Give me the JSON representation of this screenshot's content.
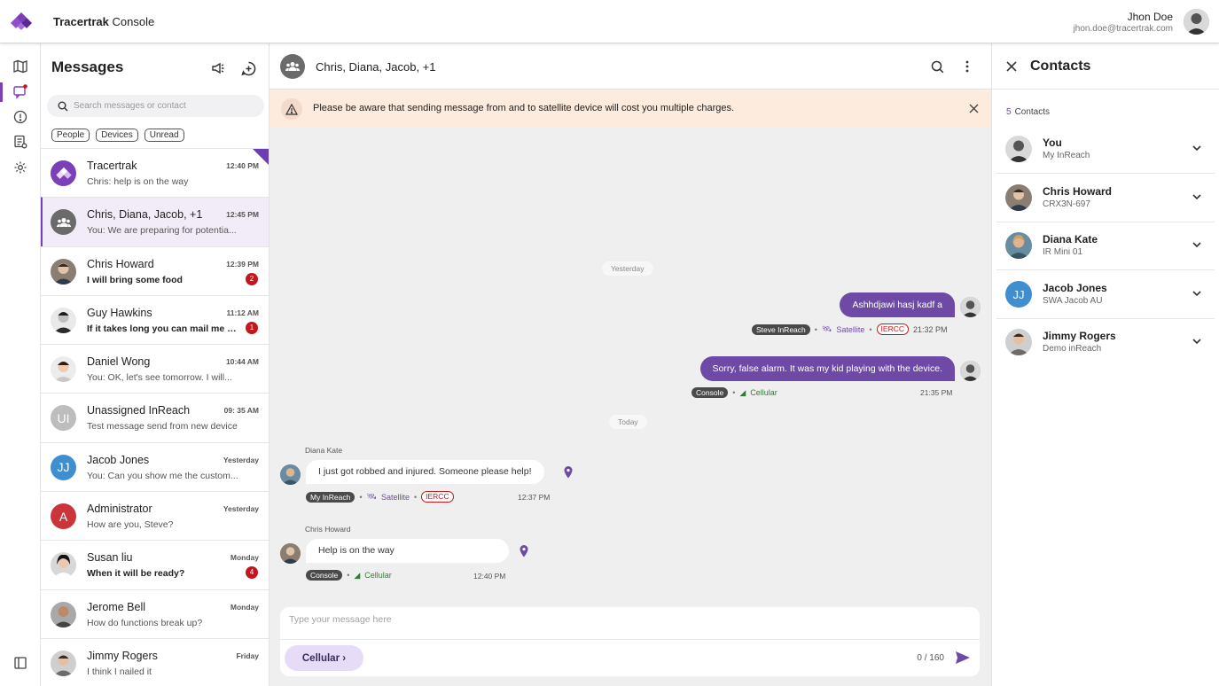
{
  "app": {
    "name_bold": "Tracertrak",
    "name_rest": " Console"
  },
  "user": {
    "name": "Jhon Doe",
    "email": "jhon.doe@tracertrak.com"
  },
  "messages_panel": {
    "title": "Messages",
    "search_placeholder": "Search messages or contact",
    "filters": [
      "People",
      "Devices",
      "Unread"
    ],
    "conversations": [
      {
        "name": "Tracertrak",
        "time": "12:40 PM",
        "preview": "Chris: help is on the way",
        "unread": "",
        "avatar": "logo",
        "active": false
      },
      {
        "name": "Chris, Diana, Jacob, +1",
        "time": "12:45 PM",
        "preview": "You: We are preparing for potentia...",
        "unread": "",
        "avatar": "group",
        "active": true
      },
      {
        "name": "Chris Howard",
        "time": "12:39 PM",
        "preview": "I will bring some food",
        "unread": "2",
        "avatar": "photo",
        "active": false
      },
      {
        "name": "Guy Hawkins",
        "time": "11:12 AM",
        "preview": "If it takes long you can mail me wi...",
        "unread": "1",
        "avatar": "photo",
        "active": false
      },
      {
        "name": "Daniel Wong",
        "time": "10:44 AM",
        "preview": "You: OK, let's see tomorrow. I will...",
        "unread": "",
        "avatar": "photo",
        "active": false
      },
      {
        "name": "Unassigned InReach",
        "time": "09: 35 AM",
        "preview": "Test message send from new device",
        "unread": "",
        "avatar": "UI",
        "active": false
      },
      {
        "name": "Jacob Jones",
        "time": "Yesterday",
        "preview": "You: Can you show me the custom...",
        "unread": "",
        "avatar": "JJ",
        "active": false
      },
      {
        "name": "Administrator",
        "time": "Yesterday",
        "preview": "How are you, Steve?",
        "unread": "",
        "avatar": "A",
        "active": false
      },
      {
        "name": "Susan liu",
        "time": "Monday",
        "preview": "When it will be ready?",
        "unread": "4",
        "avatar": "photo",
        "active": false
      },
      {
        "name": "Jerome Bell",
        "time": "Monday",
        "preview": "How do functions break up?",
        "unread": "",
        "avatar": "photo",
        "active": false
      },
      {
        "name": "Jimmy Rogers",
        "time": "Friday",
        "preview": "I think I nailed it",
        "unread": "",
        "avatar": "photo",
        "active": false
      }
    ]
  },
  "chat": {
    "title": "Chris, Diana, Jacob, +1",
    "banner": "Please be aware that sending message from and to satellite device will cost you multiple charges.",
    "day_yesterday": "Yesterday",
    "day_today": "Today",
    "messages": [
      {
        "text": "Ashhdjawi hasj kadf a",
        "device": "Steve InReach",
        "network": "Satellite",
        "tag": "IERCC",
        "time": "21:32 PM"
      },
      {
        "text": "Sorry, false alarm. It was my kid playing with the device.",
        "device": "Console",
        "network": "Cellular",
        "time": "21:35 PM"
      },
      {
        "sender": "Diana Kate",
        "text": "I just got robbed and injured. Someone please help!",
        "device": "My InReach",
        "network": "Satellite",
        "tag": "IERCC",
        "time": "12:37 PM"
      },
      {
        "sender": "Chris Howard",
        "text": "Help is on the way",
        "device": "Console",
        "network": "Cellular",
        "time": "12:40 PM"
      }
    ],
    "composer": {
      "placeholder": "Type your message here",
      "network_button": "Cellular",
      "counter": "0 / 160"
    }
  },
  "contacts": {
    "title": "Contacts",
    "count": "5",
    "count_label": "Contacts",
    "items": [
      {
        "name": "You",
        "device": "My InReach"
      },
      {
        "name": "Chris Howard",
        "device": "CRX3N-697"
      },
      {
        "name": "Diana Kate",
        "device": "IR Mini 01"
      },
      {
        "name": "Jacob Jones",
        "device": "SWA Jacob AU",
        "initials": "JJ"
      },
      {
        "name": "Jimmy Rogers",
        "device": "Demo inReach"
      }
    ]
  },
  "colors": {
    "brand": "#7b3fb8",
    "bubble_out": "#6e4aa6",
    "alert": "#c4161c",
    "banner": "#fdebdd"
  }
}
